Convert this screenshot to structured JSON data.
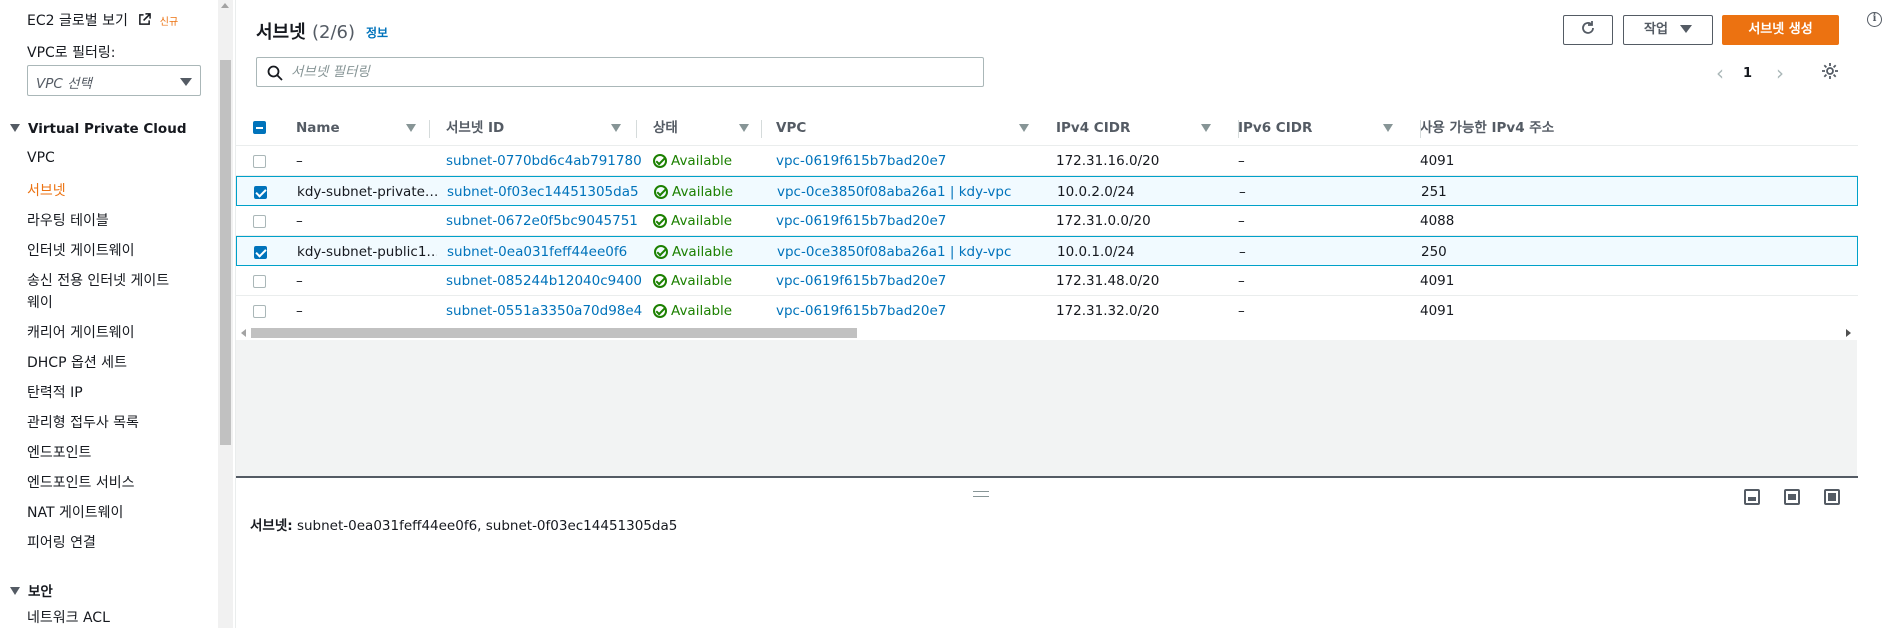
{
  "sidebar": {
    "global_view": "EC2 글로벌 보기",
    "new_badge": "신규",
    "filter_label": "VPC로 필터링:",
    "vpc_select_placeholder": "VPC 선택",
    "section_vpc": "Virtual Private Cloud",
    "items": [
      "VPC",
      "서브넷",
      "라우팅 테이블",
      "인터넷 게이트웨이",
      "송신 전용 인터넷 게이트",
      "웨이",
      "캐리어 게이트웨이",
      "DHCP 옵션 세트",
      "탄력적 IP",
      "관리형 접두사 목록",
      "엔드포인트",
      "엔드포인트 서비스",
      "NAT 게이트웨이",
      "피어링 연결"
    ],
    "active_item": "서브넷",
    "section_security": "보안",
    "security_items": [
      "네트워크 ACL"
    ]
  },
  "header": {
    "title": "서브넷",
    "count": "(2/6)",
    "info": "정보",
    "actions_label": "작업",
    "create_label": "서브넷 생성",
    "search_placeholder": "서브넷 필터링",
    "page": "1"
  },
  "table": {
    "columns": [
      "Name",
      "서브넷 ID",
      "상태",
      "VPC",
      "IPv4 CIDR",
      "IPv6 CIDR",
      "사용 가능한 IPv4 주소"
    ],
    "rows": [
      {
        "name": "–",
        "subnet_id": "subnet-0770bd6c4ab791780",
        "status": "Available",
        "vpc": "vpc-0619f615b7bad20e7",
        "ipv4": "172.31.16.0/20",
        "ipv6": "–",
        "avail": "4091",
        "selected": false
      },
      {
        "name": "kdy-subnet-private…",
        "subnet_id": "subnet-0f03ec14451305da5",
        "status": "Available",
        "vpc": "vpc-0ce3850f08aba26a1 | kdy-vpc",
        "ipv4": "10.0.2.0/24",
        "ipv6": "–",
        "avail": "251",
        "selected": true
      },
      {
        "name": "–",
        "subnet_id": "subnet-0672e0f5bc9045751",
        "status": "Available",
        "vpc": "vpc-0619f615b7bad20e7",
        "ipv4": "172.31.0.0/20",
        "ipv6": "–",
        "avail": "4088",
        "selected": false
      },
      {
        "name": "kdy-subnet-public1…",
        "subnet_id": "subnet-0ea031feff44ee0f6",
        "status": "Available",
        "vpc": "vpc-0ce3850f08aba26a1 | kdy-vpc",
        "ipv4": "10.0.1.0/24",
        "ipv6": "–",
        "avail": "250",
        "selected": true
      },
      {
        "name": "–",
        "subnet_id": "subnet-085244b12040c9400",
        "status": "Available",
        "vpc": "vpc-0619f615b7bad20e7",
        "ipv4": "172.31.48.0/20",
        "ipv6": "–",
        "avail": "4091",
        "selected": false
      },
      {
        "name": "–",
        "subnet_id": "subnet-0551a3350a70d98e4",
        "status": "Available",
        "vpc": "vpc-0619f615b7bad20e7",
        "ipv4": "172.31.32.0/20",
        "ipv6": "–",
        "avail": "4091",
        "selected": false
      }
    ]
  },
  "detail": {
    "label": "서브넷:",
    "value": "subnet-0ea031feff44ee0f6, subnet-0f03ec14451305da5"
  },
  "colors": {
    "accent": "#ec7211",
    "link": "#0073bb",
    "success": "#1d8102"
  }
}
